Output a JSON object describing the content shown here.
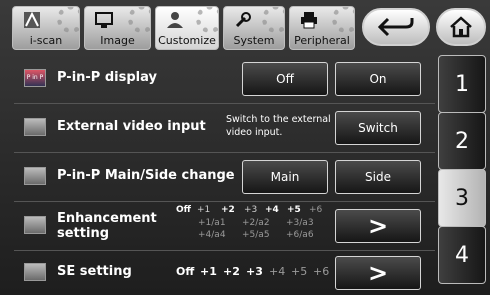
{
  "tabs": [
    {
      "label": "i-scan",
      "icon": "i-scan-icon"
    },
    {
      "label": "Image",
      "icon": "monitor-icon"
    },
    {
      "label": "Customize",
      "icon": "user-icon"
    },
    {
      "label": "System",
      "icon": "wrench-icon"
    },
    {
      "label": "Peripheral",
      "icon": "printer-icon"
    }
  ],
  "active_tab": "Customize",
  "nav": {
    "back_icon": "back-arrow-icon",
    "home_icon": "home-icon"
  },
  "rows": {
    "pinp": {
      "label": "P-in-P display",
      "icon_text": "P in P",
      "off": "Off",
      "on": "On"
    },
    "ext": {
      "label": "External video input",
      "desc_line1": "Switch to the external",
      "desc_line2": "video input.",
      "button": "Switch"
    },
    "change": {
      "label": "P-in-P Main/Side change",
      "main": "Main",
      "side": "Side"
    },
    "enh": {
      "label_line1": "Enhancement",
      "label_line2": "setting",
      "off": "Off",
      "r1": [
        "+1",
        "+2",
        "+3",
        "+4",
        "+5",
        "+6"
      ],
      "r2": [
        "+1/a1",
        "+2/a2",
        "+3/a3"
      ],
      "r3": [
        "+4/a4",
        "+5/a5",
        "+6/a6"
      ],
      "button": ">"
    },
    "se": {
      "label": "SE setting",
      "off": "Off",
      "levels": [
        "+1",
        "+2",
        "+3",
        "+4",
        "+5",
        "+6"
      ],
      "button": ">"
    }
  },
  "side_tabs": [
    "1",
    "2",
    "3",
    "4"
  ],
  "active_side_tab": "3"
}
